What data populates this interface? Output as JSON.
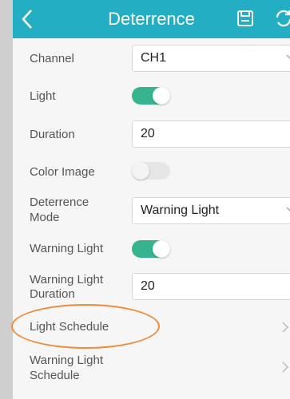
{
  "header": {
    "title": "Deterrence",
    "back_icon": "back-arrow-icon",
    "save_icon": "save-icon",
    "refresh_icon": "refresh-icon",
    "color": "#23aec3"
  },
  "settings": {
    "channel": {
      "label": "Channel",
      "value": "CH1"
    },
    "light": {
      "label": "Light",
      "enabled": true
    },
    "duration": {
      "label": "Duration",
      "value": "20"
    },
    "color_image": {
      "label": "Color Image",
      "enabled": false
    },
    "deterrence_mode": {
      "label_line1": "Deterrence",
      "label_line2": "Mode",
      "value": "Warning Light"
    },
    "warning_light": {
      "label": "Warning Light",
      "enabled": true
    },
    "warning_light_duration": {
      "label_line1": "Warning Light",
      "label_line2": "Duration",
      "value": "20"
    },
    "light_schedule": {
      "label": "Light Schedule"
    },
    "warning_light_schedule": {
      "label_line1": "Warning Light",
      "label_line2": "Schedule"
    }
  },
  "colors": {
    "toggle_on": "#37b38f",
    "highlight": "#f08a3a"
  }
}
